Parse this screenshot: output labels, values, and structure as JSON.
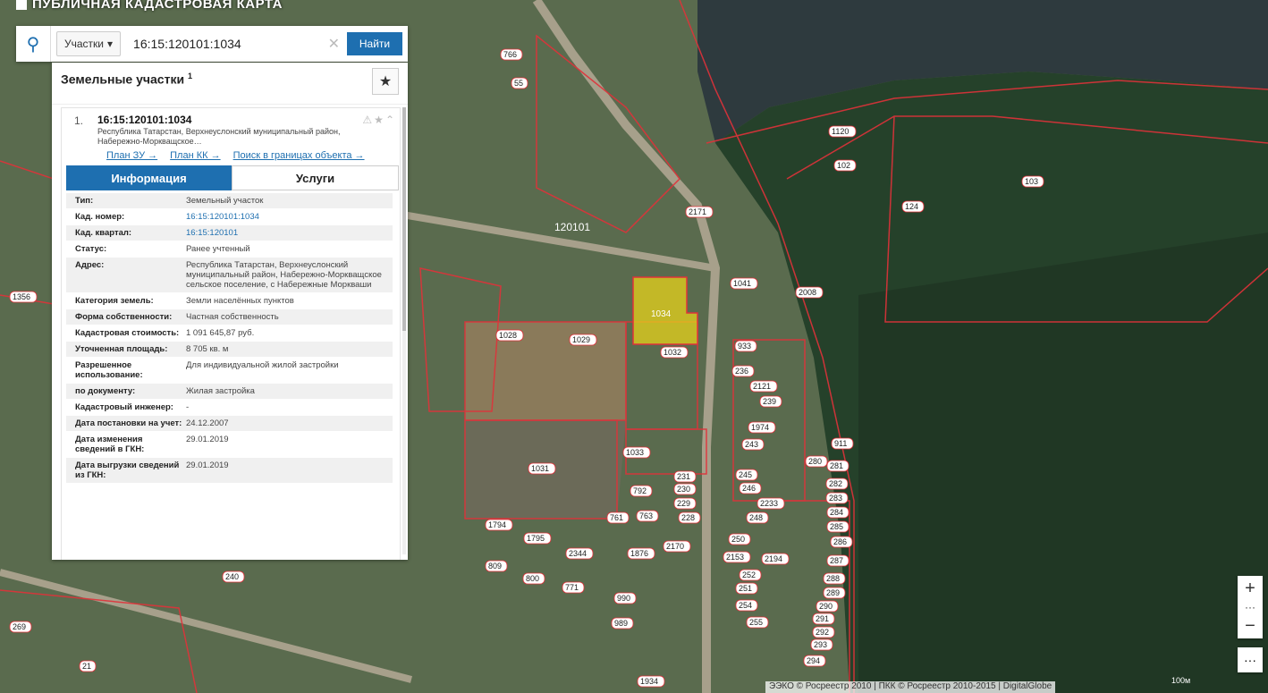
{
  "app": {
    "title": "ПУБЛИЧНАЯ КАДАСТРОВАЯ КАРТА"
  },
  "search": {
    "type_label": "Участки",
    "value": "16:15:120101:1034",
    "find_label": "Найти"
  },
  "panel": {
    "title": "Земельные участки",
    "count": "1",
    "item": {
      "num": "1.",
      "id": "16:15:120101:1034",
      "address": "Республика Татарстан, Верхнеуслонский муниципальный район, Набережно-Моркващское…",
      "links": [
        "План ЗУ →",
        "План КК →",
        "Поиск в границах объекта →"
      ]
    },
    "tabs": [
      "Информация",
      "Услуги"
    ],
    "rows": [
      {
        "k": "Тип:",
        "v": "Земельный участок"
      },
      {
        "k": "Кад. номер:",
        "v": "16:15:120101:1034"
      },
      {
        "k": "Кад. квартал:",
        "v": "16:15:120101"
      },
      {
        "k": "Статус:",
        "v": "Ранее учтенный"
      },
      {
        "k": "Адрес:",
        "v": "Республика Татарстан, Верхнеуслонский муниципальный район, Набережно-Моркващское сельское поселение, с Набережные Моркваши"
      },
      {
        "k": "Категория земель:",
        "v": "Земли населённых пунктов"
      },
      {
        "k": "Форма собственности:",
        "v": "Частная собственность"
      },
      {
        "k": "Кадастровая стоимость:",
        "v": "1 091 645,87 руб."
      },
      {
        "k": "Уточненная площадь:",
        "v": "8 705 кв. м"
      },
      {
        "k": "Разрешенное использование:",
        "v": "Для индивидуальной жилой застройки"
      },
      {
        "k": "по документу:",
        "v": "Жилая застройка"
      },
      {
        "k": "Кадастровый инженер:",
        "v": "-"
      },
      {
        "k": "Дата постановки на учет:",
        "v": "24.12.2007"
      },
      {
        "k": "Дата изменения сведений в ГКН:",
        "v": "29.01.2019"
      },
      {
        "k": "Дата выгрузки сведений из ГКН:",
        "v": "29.01.2019"
      }
    ]
  },
  "map_labels": {
    "quarter": "120101",
    "selected": "1034",
    "parcels": [
      "766",
      "55",
      "103",
      "102",
      "1029",
      "1028",
      "1031",
      "1032",
      "1033",
      "2171",
      "933",
      "911",
      "2233",
      "2194",
      "2153",
      "1356",
      "21",
      "269",
      "1876",
      "2170",
      "990",
      "989",
      "1934",
      "2344",
      "1794",
      "1795",
      "809",
      "800",
      "771",
      "792",
      "761",
      "763",
      "240",
      "1041",
      "236",
      "2121",
      "239",
      "1974",
      "243",
      "245",
      "246",
      "248",
      "250",
      "252",
      "251",
      "254",
      "255",
      "280",
      "281",
      "282",
      "283",
      "284",
      "285",
      "286",
      "287",
      "288",
      "289",
      "290",
      "291",
      "292",
      "293",
      "294",
      "231",
      "230",
      "229",
      "228",
      "2008",
      "1120",
      "124"
    ]
  },
  "controls": {
    "zoom_in": "+",
    "zoom_out": "−"
  },
  "attribution": "ЭЭКО © Росреестр 2010 | ПКК © Росреестр 2010-2015 | DigitalGlobe",
  "scale": "100м"
}
